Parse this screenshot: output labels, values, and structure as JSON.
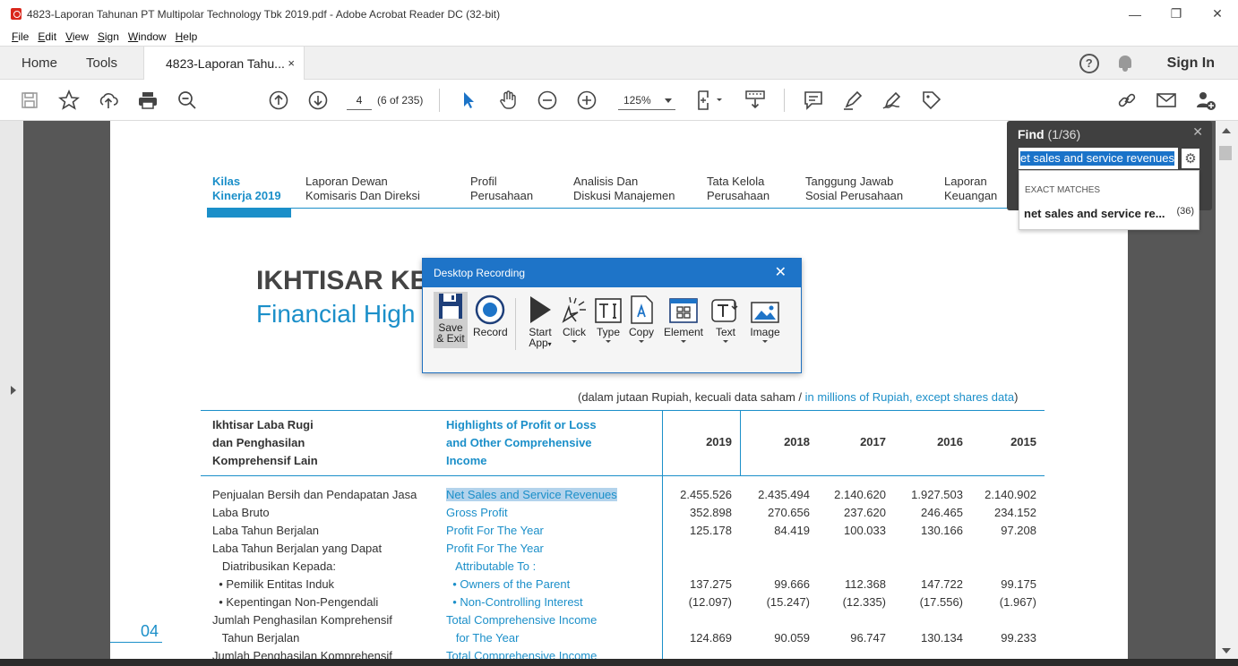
{
  "window": {
    "title": "4823-Laporan Tahunan PT Multipolar Technology Tbk 2019.pdf - Adobe Acrobat Reader DC (32-bit)",
    "minimize": "—",
    "maximize": "❐",
    "close": "✕"
  },
  "menu": {
    "items": [
      {
        "label": "File",
        "mnemonic": "F",
        "rest": "ile"
      },
      {
        "label": "Edit",
        "mnemonic": "E",
        "rest": "dit"
      },
      {
        "label": "View",
        "mnemonic": "V",
        "rest": "iew"
      },
      {
        "label": "Sign",
        "mnemonic": "S",
        "rest": "ign"
      },
      {
        "label": "Window",
        "mnemonic": "W",
        "rest": "indow"
      },
      {
        "label": "Help",
        "mnemonic": "H",
        "rest": "elp"
      }
    ]
  },
  "tabs": {
    "home": "Home",
    "tools": "Tools",
    "doc": "4823-Laporan Tahu...",
    "doc_close": "×",
    "help": "?",
    "sign_in": "Sign In"
  },
  "toolbar": {
    "page_current": "4",
    "page_of": "(6 of 235)",
    "zoom": "125%"
  },
  "find": {
    "title": "Find",
    "count": "(1/36)",
    "close": "✕",
    "query": "et sales and service revenues",
    "gear": "⚙",
    "exact_label": "EXACT MATCHES",
    "match_text": "net sales and service re...",
    "match_count": "(36)"
  },
  "recording": {
    "title": "Desktop Recording",
    "close": "✕",
    "buttons": {
      "save_l1": "Save",
      "save_l2": "& Exit",
      "record": "Record",
      "start_l1": "Start",
      "start_l2": "App",
      "click": "Click",
      "type": "Type",
      "copy": "Copy",
      "element": "Element",
      "text": "Text",
      "image": "Image"
    }
  },
  "page": {
    "nav": [
      {
        "l1": "Kilas",
        "l2": "Kinerja 2019"
      },
      {
        "l1": "Laporan Dewan",
        "l2": "Komisaris Dan Direksi"
      },
      {
        "l1": "Profil",
        "l2": "Perusahaan"
      },
      {
        "l1": "Analisis Dan",
        "l2": "Diskusi Manajemen"
      },
      {
        "l1": "Tata Kelola",
        "l2": "Perusahaan"
      },
      {
        "l1": "Tanggung Jawab",
        "l2": "Sosial Perusahaan"
      },
      {
        "l1": "Laporan",
        "l2": "Keuangan"
      }
    ],
    "heading_id": "IKHTISAR KE",
    "heading_en": "Financial High",
    "units_pre": "(dalam jutaan Rupiah, kecuali data saham / ",
    "units_en": "in millions of Rupiah, except shares data",
    "units_post": ")",
    "table_header": {
      "id_l1": "Ikhtisar Laba Rugi",
      "id_l2": "dan Penghasilan",
      "id_l3": "Komprehensif Lain",
      "en_l1": "Highlights of Profit or Loss",
      "en_l2": "and Other Comprehensive",
      "en_l3": "Income",
      "years": [
        "2019",
        "2018",
        "2017",
        "2016",
        "2015"
      ]
    },
    "rows": [
      {
        "id": "Penjualan Bersih dan Pendapatan Jasa",
        "en": "Net Sales and Service Revenues",
        "values": [
          "2.455.526",
          "2.435.494",
          "2.140.620",
          "1.927.503",
          "2.140.902"
        ]
      },
      {
        "id": "Laba Bruto",
        "en": "Gross Profit",
        "values": [
          "352.898",
          "270.656",
          "237.620",
          "246.465",
          "234.152"
        ]
      },
      {
        "id": "Laba Tahun Berjalan",
        "en": "Profit For The Year",
        "values": [
          "125.178",
          "84.419",
          "100.033",
          "130.166",
          "97.208"
        ]
      },
      {
        "id": "Laba Tahun Berjalan yang Dapat",
        "en": "Profit For The Year",
        "values": [
          "",
          "",
          "",
          "",
          ""
        ]
      },
      {
        "id": "   Diatribusikan Kepada:",
        "en": "   Attributable To :",
        "values": [
          "",
          "",
          "",
          "",
          ""
        ]
      },
      {
        "id": "  • Pemilik Entitas Induk",
        "en": "  • Owners of the Parent",
        "values": [
          "137.275",
          "99.666",
          "112.368",
          "147.722",
          "99.175"
        ]
      },
      {
        "id": "  • Kepentingan Non-Pengendali",
        "en": "  • Non-Controlling Interest",
        "values": [
          "(12.097)",
          "(15.247)",
          "(12.335)",
          "(17.556)",
          "(1.967)"
        ]
      },
      {
        "id": "Jumlah Penghasilan Komprehensif",
        "en": "Total Comprehensive Income",
        "values": [
          "",
          "",
          "",
          "",
          ""
        ]
      },
      {
        "id": "   Tahun Berjalan",
        "en": "   for The Year",
        "values": [
          "124.869",
          "90.059",
          "96.747",
          "130.134",
          "99.233"
        ]
      },
      {
        "id": "Jumlah Penghasilan Komprehensif",
        "en": "Total Comprehensive Income",
        "values": [
          "",
          "",
          "",
          "",
          ""
        ]
      }
    ],
    "page_number": "04"
  }
}
